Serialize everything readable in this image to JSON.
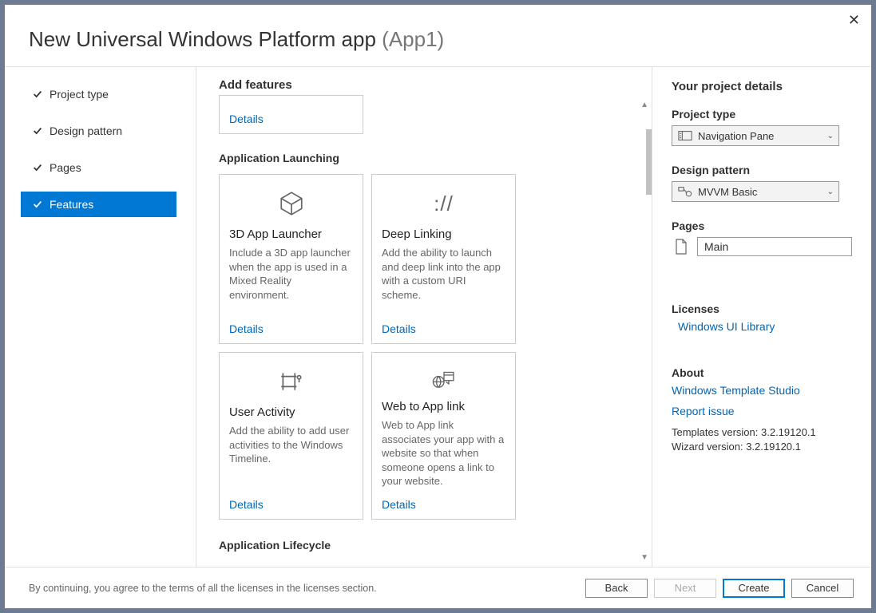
{
  "title": {
    "main": "New Universal Windows Platform app",
    "sub": "(App1)"
  },
  "sidebar": {
    "items": [
      {
        "label": "Project type"
      },
      {
        "label": "Design pattern"
      },
      {
        "label": "Pages"
      },
      {
        "label": "Features"
      }
    ]
  },
  "main": {
    "top_heading": "Add features",
    "truncated_details": "Details",
    "section1_label": "Application Launching",
    "cards": [
      {
        "title": "3D App Launcher",
        "desc": "Include a 3D app launcher when the app is used in a Mixed Reality environment.",
        "details": "Details"
      },
      {
        "title": "Deep Linking",
        "desc": "Add the ability to launch and deep link into the app with a custom URI scheme.",
        "details": "Details"
      },
      {
        "title": "User Activity",
        "desc": "Add the ability to add user activities to the Windows Timeline.",
        "details": "Details"
      },
      {
        "title": "Web to App link",
        "desc": "Web to App link associates your app with a website so that when someone opens a link to your website.",
        "details": "Details"
      }
    ],
    "section2_label": "Application Lifecycle",
    "deep_linking_icon_text": "://"
  },
  "details": {
    "heading": "Your project details",
    "project_type_label": "Project type",
    "project_type_value": "Navigation Pane",
    "design_pattern_label": "Design pattern",
    "design_pattern_value": "MVVM Basic",
    "pages_label": "Pages",
    "page_name": "Main",
    "licenses_label": "Licenses",
    "licenses_link": "Windows UI Library",
    "about_label": "About",
    "about_link1": "Windows Template Studio",
    "about_link2": "Report issue",
    "templates_version": "Templates version: 3.2.19120.1",
    "wizard_version": "Wizard version: 3.2.19120.1"
  },
  "footer": {
    "agree": "By continuing, you agree to the terms of all the licenses in the licenses section.",
    "back": "Back",
    "next": "Next",
    "create": "Create",
    "cancel": "Cancel"
  }
}
